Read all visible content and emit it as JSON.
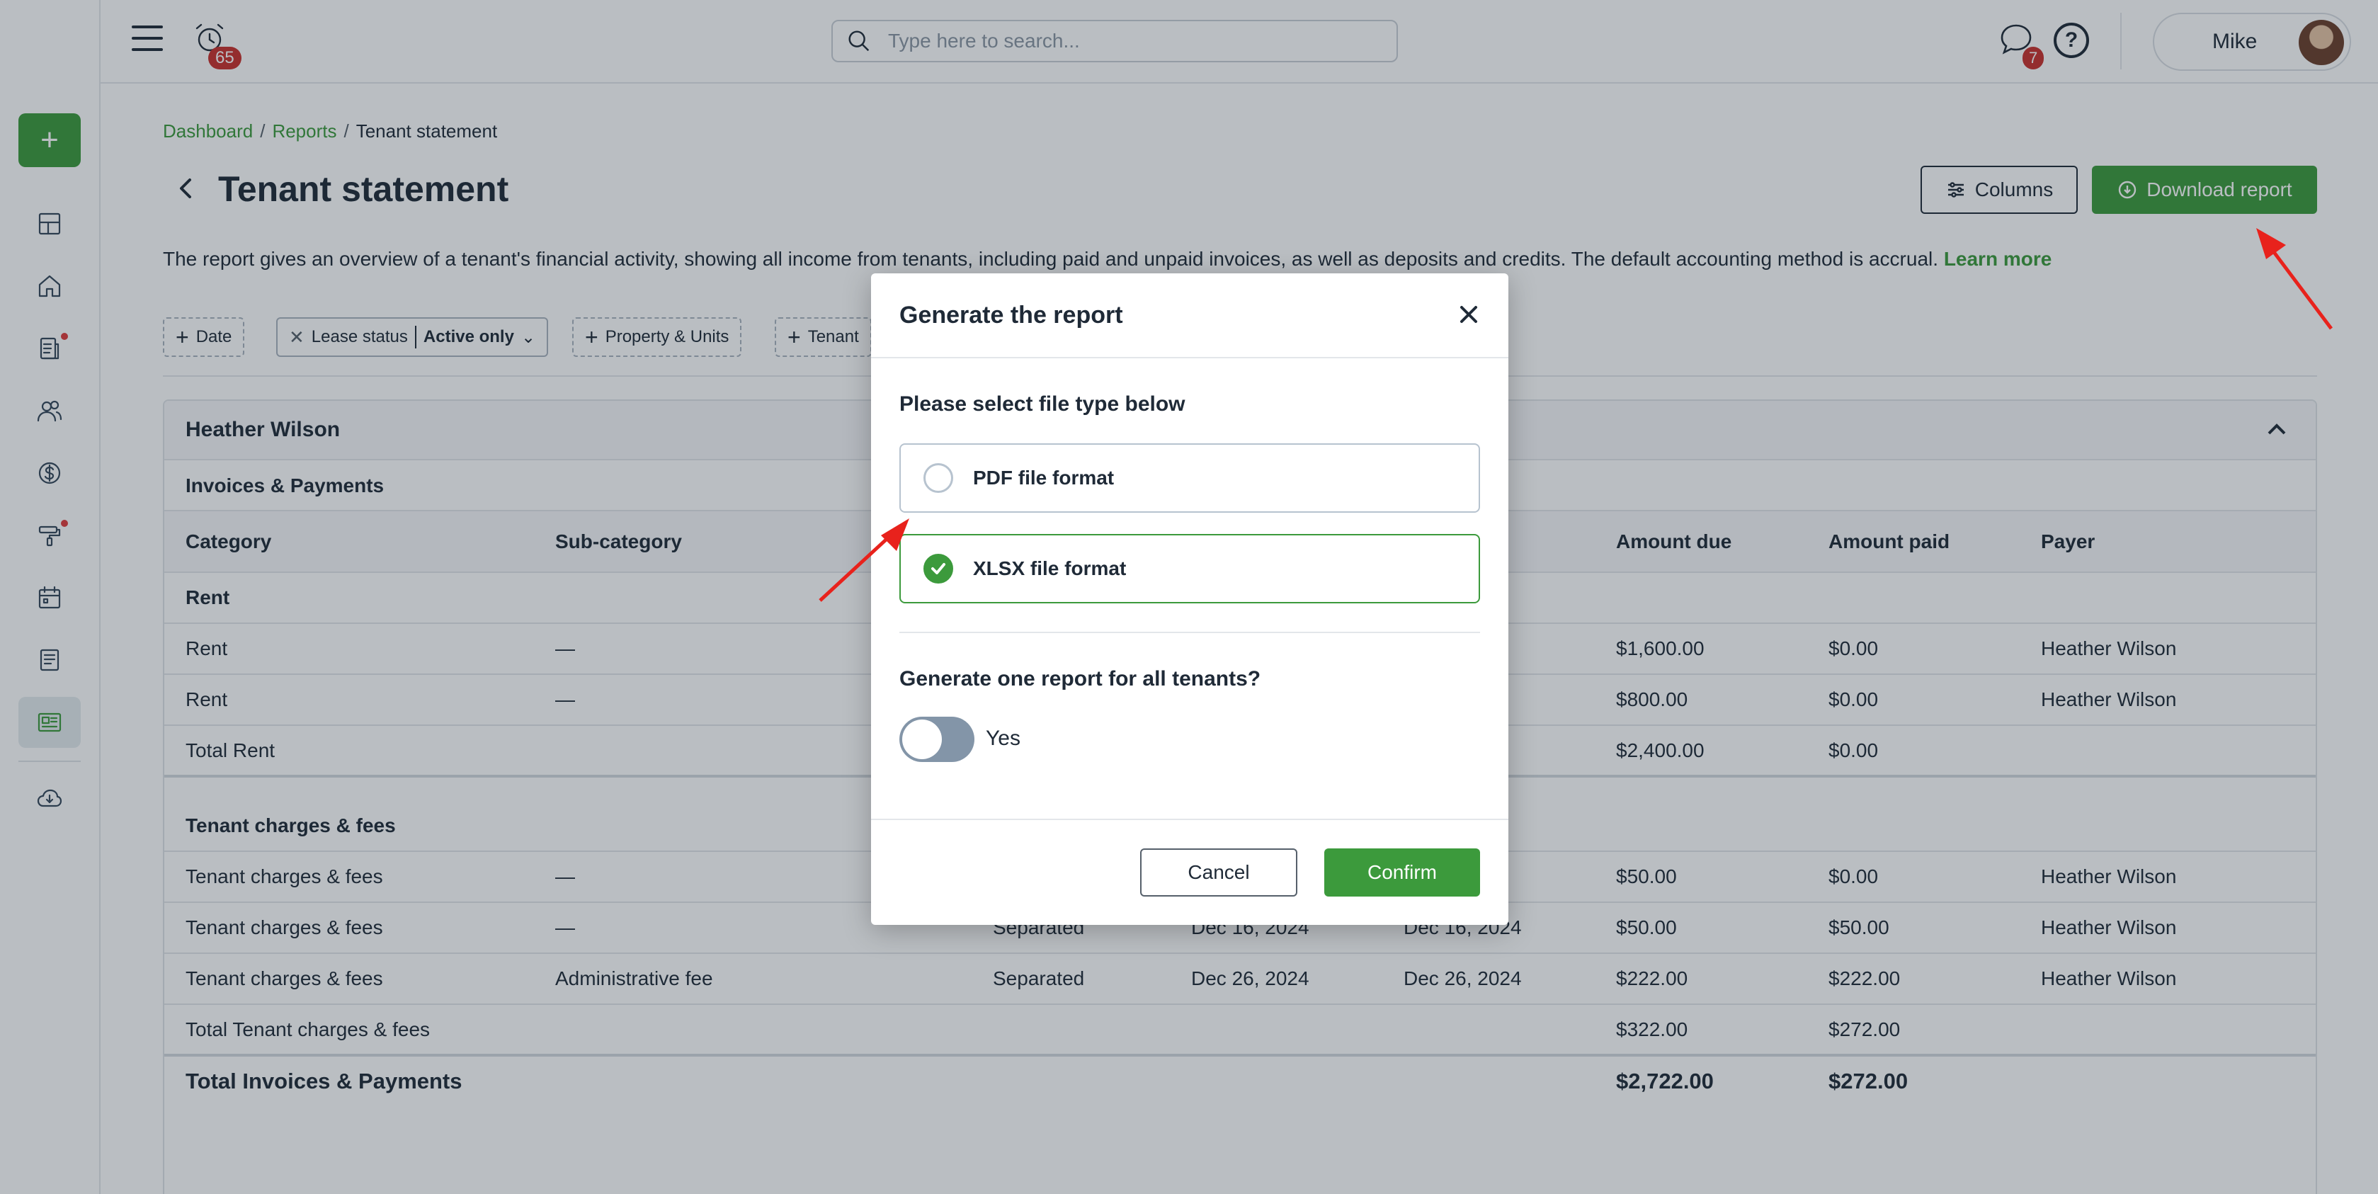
{
  "topbar": {
    "alarm_count": "65",
    "search_placeholder": "Type here to search...",
    "chat_count": "7",
    "help_glyph": "?",
    "user_name": "Mike"
  },
  "sidebar": {
    "add_glyph": "+",
    "items": [
      {
        "icon": "dashboard-icon"
      },
      {
        "icon": "home-icon"
      },
      {
        "icon": "leases-icon",
        "dot": true
      },
      {
        "icon": "people-icon"
      },
      {
        "icon": "dollar-icon"
      },
      {
        "icon": "maintenance-icon",
        "dot": true
      },
      {
        "icon": "calendar-icon"
      },
      {
        "icon": "document-icon"
      },
      {
        "icon": "reports-icon",
        "active": true
      },
      {
        "icon": "download-cloud-icon"
      }
    ]
  },
  "breadcrumb": {
    "items": [
      "Dashboard",
      "Reports"
    ],
    "separator": "/",
    "current": "Tenant statement"
  },
  "page": {
    "title": "Tenant statement",
    "columns_button": "Columns",
    "download_button": "Download report",
    "description": "The report gives an overview of a tenant's financial activity, showing all income from tenants, including paid and unpaid invoices, as well as deposits and credits. The default accounting method is accrual.",
    "learn_more": "Learn more"
  },
  "filters": {
    "date": "Date",
    "lease_status_label": "Lease status",
    "lease_status_value": "Active only",
    "property": "Property & Units",
    "tenant": "Tenant"
  },
  "report": {
    "tenant_name": "Heather Wilson",
    "section_title": "Invoices & Payments",
    "columns": [
      "Category",
      "Sub-category",
      "",
      "",
      "",
      "Amount due",
      "Amount paid",
      "Payer"
    ],
    "groups": [
      {
        "title": "Rent",
        "rows": [
          [
            "Rent",
            "—",
            "",
            "",
            "",
            "$1,600.00",
            "$0.00",
            "Heather Wilson"
          ],
          [
            "Rent",
            "—",
            "",
            "",
            "",
            "$800.00",
            "$0.00",
            "Heather Wilson"
          ]
        ],
        "total": [
          "Total Rent",
          "$2,400.00",
          "$0.00"
        ]
      },
      {
        "title": "Tenant charges & fees",
        "rows": [
          [
            "Tenant charges & fees",
            "—",
            "",
            "",
            "",
            "$50.00",
            "$0.00",
            "Heather Wilson"
          ],
          [
            "Tenant charges & fees",
            "—",
            "Separated",
            "Dec 16, 2024",
            "Dec 16, 2024",
            "$50.00",
            "$50.00",
            "Heather Wilson"
          ],
          [
            "Tenant charges & fees",
            "Administrative fee",
            "Separated",
            "Dec 26, 2024",
            "Dec 26, 2024",
            "$222.00",
            "$222.00",
            "Heather Wilson"
          ]
        ],
        "total": [
          "Total Tenant charges & fees",
          "$322.00",
          "$272.00"
        ]
      }
    ],
    "grand_total": [
      "Total Invoices & Payments",
      "$2,722.00",
      "$272.00"
    ]
  },
  "modal": {
    "title": "Generate the report",
    "file_type_prompt": "Please select file type below",
    "options": [
      {
        "label": "PDF file format",
        "selected": false
      },
      {
        "label": "XLSX file format",
        "selected": true
      }
    ],
    "all_tenants_prompt": "Generate one report for all tenants?",
    "toggle_label": "Yes",
    "toggle_on": false,
    "cancel": "Cancel",
    "confirm": "Confirm"
  },
  "colors": {
    "accent": "#3c9a3c",
    "badge": "#c9302c",
    "annotation_arrow": "#e8221c"
  }
}
